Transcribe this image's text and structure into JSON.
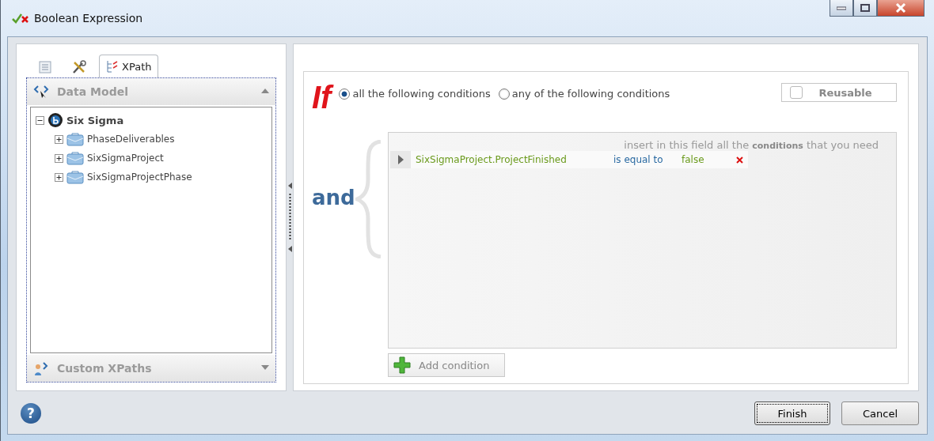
{
  "window": {
    "title": "Boolean Expression"
  },
  "left_panel": {
    "tabs": [
      {
        "kind": "document",
        "selected": false
      },
      {
        "kind": "tools",
        "selected": false
      },
      {
        "kind": "xpath",
        "label": "XPath",
        "selected": true
      }
    ],
    "sections": [
      {
        "title": "Data Model",
        "expanded": true
      },
      {
        "title": "Custom XPaths",
        "expanded": false
      }
    ],
    "tree": [
      {
        "label": "Six Sigma",
        "expanded": true,
        "children": [
          {
            "label": "PhaseDeliverables",
            "expanded": false
          },
          {
            "label": "SixSigmaProject",
            "expanded": false
          },
          {
            "label": "SixSigmaProjectPhase",
            "expanded": false
          }
        ]
      }
    ]
  },
  "editor": {
    "if_label": "If",
    "modes": [
      {
        "label": "all the following conditions",
        "selected": true
      },
      {
        "label": "any of the following conditions",
        "selected": false
      }
    ],
    "reusable": {
      "label": "Reusable",
      "checked": false
    },
    "join_label": "and",
    "hint": "insert in this field all the **conditions** that you need",
    "conditions": [
      {
        "field": "SixSigmaProject.ProjectFinished",
        "operator": "is equal to",
        "value": "false"
      }
    ],
    "add_button": "Add condition"
  },
  "help_label": "?",
  "buttons": [
    {
      "label": "Finish",
      "default": true
    },
    {
      "label": "Cancel",
      "default": false
    }
  ]
}
